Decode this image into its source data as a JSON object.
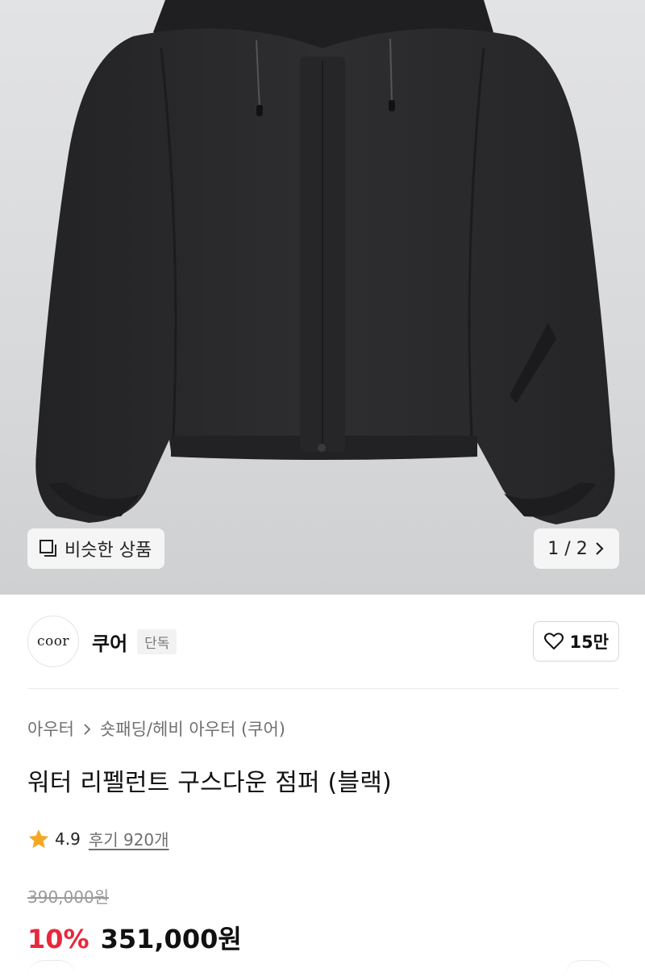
{
  "gallery": {
    "similar_label": "비슷한 상품",
    "page_indicator": "1 / 2",
    "image_icon": "jacket-photo"
  },
  "brand": {
    "logo_text": "coor",
    "name": "쿠어",
    "badge": "단독",
    "likes": "15만"
  },
  "product": {
    "breadcrumb": [
      "아우터",
      "숏패딩/헤비 아우터 (쿠어)"
    ],
    "title": "워터 리펠런트 구스다운 점퍼 (블랙)",
    "rating": "4.9",
    "reviews": "후기 920개",
    "original_price": "390,000원",
    "discount": "10%",
    "sale_price": "351,000원"
  },
  "colors": {
    "accent_red": "#e8283b",
    "star": "#f5a623",
    "jacket": "#2b2b2d"
  }
}
